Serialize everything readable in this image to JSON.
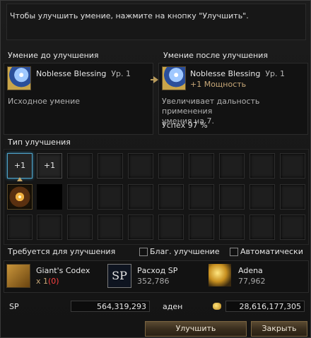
{
  "hint": "Чтобы улучшить умение, нажмите на кнопку \"Улучшить\".",
  "before": {
    "title": "Умение до улучшения",
    "skill_name": "Noblesse Blessing",
    "level": "Ур. 1",
    "description": "Исходное умение",
    "icon": "noblesse-blessing-icon"
  },
  "after": {
    "title": "Умение после улучшения",
    "skill_name": "Noblesse Blessing",
    "level": "Ур. 1",
    "enchant": "+1 Мощность",
    "description_line1": "Увеличивает дальность применения",
    "description_line2": "умения на 7.",
    "success": "Успех 97 %"
  },
  "upgrade_type": {
    "title": "Тип улучшения",
    "option1": "+1",
    "option2": "+1"
  },
  "requirements": {
    "title": "Требуется для улучшения",
    "blessed_label": "Благ. улучшение",
    "auto_label": "Автоматически",
    "item1_name": "Giant's Codex",
    "item1_qty_prefix": "x 1",
    "item1_qty_have": "(0)",
    "item2_name": "Расход SP",
    "item2_value": "352,786",
    "item3_name": "Adena",
    "item3_value": "77,962"
  },
  "totals": {
    "sp_label": "SP",
    "sp_value": "564,319,293",
    "adena_label": "аден",
    "adena_value": "28,616,177,305"
  },
  "buttons": {
    "upgrade": "Улучшить",
    "close": "Закрыть"
  },
  "colors": {
    "accent": "#c8a878",
    "missing": "#ff4040",
    "selected": "#4fa3c8"
  }
}
